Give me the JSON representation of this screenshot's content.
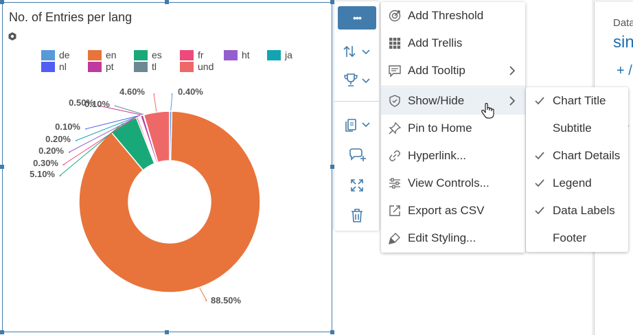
{
  "chart": {
    "title": "No. of Entries per lang",
    "legend": [
      {
        "label": "de",
        "color": "#5899da"
      },
      {
        "label": "en",
        "color": "#e8743b"
      },
      {
        "label": "es",
        "color": "#19a979"
      },
      {
        "label": "fr",
        "color": "#ed4a7b"
      },
      {
        "label": "ht",
        "color": "#945ecf"
      },
      {
        "label": "ja",
        "color": "#13a4b4"
      },
      {
        "label": "nl",
        "color": "#525df4"
      },
      {
        "label": "pt",
        "color": "#bf399e"
      },
      {
        "label": "tl",
        "color": "#6c8893"
      },
      {
        "label": "und",
        "color": "#ee6868"
      }
    ]
  },
  "chart_data": {
    "type": "pie",
    "title": "No. of Entries per lang",
    "donut": true,
    "legend_position": "top",
    "slices": [
      {
        "label": "und",
        "value": 4.6,
        "data_label": "4.60%",
        "color": "#ee6868"
      },
      {
        "label": "tl",
        "value": 0.1,
        "data_label": "0.10%",
        "color": "#6c8893"
      },
      {
        "label": "pt",
        "value": 0.5,
        "data_label": "0.50%",
        "color": "#bf399e"
      },
      {
        "label": "nl",
        "value": 0.1,
        "data_label": "0.10%",
        "color": "#525df4"
      },
      {
        "label": "ja",
        "value": 0.2,
        "data_label": "0.20%",
        "color": "#13a4b4"
      },
      {
        "label": "ht",
        "value": 0.2,
        "data_label": "0.20%",
        "color": "#945ecf"
      },
      {
        "label": "fr",
        "value": 0.3,
        "data_label": "0.30%",
        "color": "#ed4a7b"
      },
      {
        "label": "es",
        "value": 5.1,
        "data_label": "5.10%",
        "color": "#19a979"
      },
      {
        "label": "en",
        "value": 88.5,
        "data_label": "88.50%",
        "color": "#e8743b"
      },
      {
        "label": "de",
        "value": 0.4,
        "data_label": "0.40%",
        "color": "#5899da"
      }
    ]
  },
  "toolbar": {
    "more_label": "•••",
    "items": [
      {
        "icon": "sort-icon"
      },
      {
        "icon": "rank-trophy-icon"
      },
      {
        "icon": "copy-icon"
      },
      {
        "icon": "add-comment-icon"
      },
      {
        "icon": "fullscreen-icon"
      },
      {
        "icon": "delete-icon"
      }
    ]
  },
  "context_menu": {
    "items": [
      {
        "label": "Add Threshold",
        "icon": "threshold-icon"
      },
      {
        "label": "Add Trellis",
        "icon": "grid-icon"
      },
      {
        "label": "Add Tooltip",
        "icon": "tooltip-icon",
        "submenu": true
      },
      {
        "label": "Show/Hide",
        "icon": "show-hide-icon",
        "submenu": true,
        "highlighted": true
      },
      {
        "label": "Pin to Home",
        "icon": "pin-icon"
      },
      {
        "label": "Hyperlink...",
        "icon": "link-icon"
      },
      {
        "label": "View Controls...",
        "icon": "controls-icon"
      },
      {
        "label": "Export as CSV",
        "icon": "export-icon"
      },
      {
        "label": "Edit Styling...",
        "icon": "brush-icon"
      }
    ]
  },
  "showhide_menu": {
    "items": [
      {
        "label": "Chart Title",
        "checked": true
      },
      {
        "label": "Subtitle",
        "checked": false
      },
      {
        "label": "Chart Details",
        "checked": true
      },
      {
        "label": "Legend",
        "checked": true
      },
      {
        "label": "Data Labels",
        "checked": true
      },
      {
        "label": "Footer",
        "checked": false
      }
    ]
  },
  "right_panel": {
    "label": "Data",
    "name": "sin",
    "add_label": "+ /"
  },
  "colors": {
    "accent": "#427cac",
    "highlight": "#ebf0f5",
    "link": "#1f6fb2"
  }
}
